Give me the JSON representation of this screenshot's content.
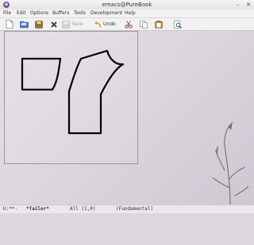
{
  "window": {
    "title": "emacs@PureBook",
    "app_icon_glyph": "e",
    "minimize_glyph": "–",
    "close_glyph": "✕"
  },
  "menubar": {
    "items": [
      "File",
      "Edit",
      "Options",
      "Buffers",
      "Tools",
      "Development",
      "Help"
    ]
  },
  "toolbar": {
    "icons": [
      "new-file-icon",
      "open-folder-icon",
      "save-icon",
      "close-icon",
      "cut-icon",
      "copy-icon",
      "paste-icon",
      "search-icon",
      "undo-icon"
    ],
    "save_label": "Save",
    "undo_label": "Undo"
  },
  "modeline": {
    "status": "U:**-",
    "buffer": "*Tailor*",
    "position": "All (1,0)",
    "mode": "(Fundamental)"
  },
  "colors": {
    "modeline_bg": "#ece6ee",
    "emacs_purple": "#7b4fa0"
  }
}
